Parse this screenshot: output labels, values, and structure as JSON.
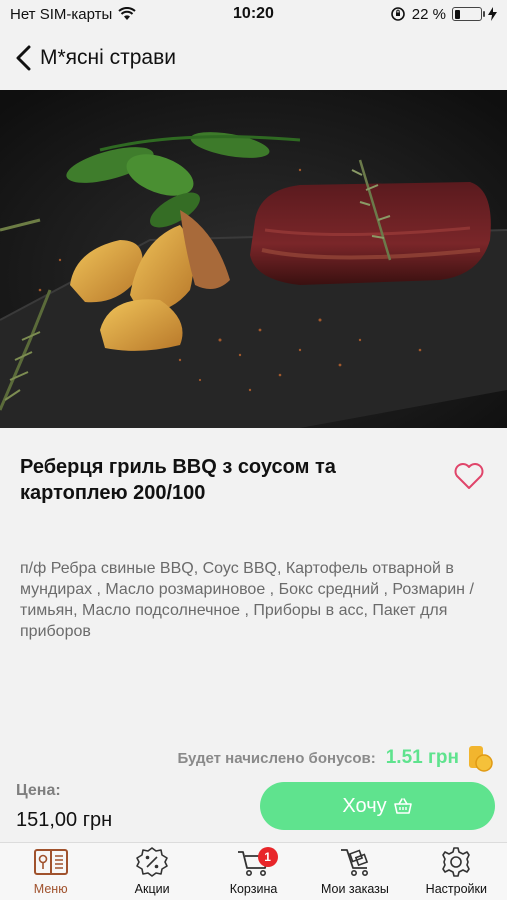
{
  "status_bar": {
    "carrier": "Нет SIM-карты",
    "time": "10:20",
    "battery_percent": "22 %",
    "battery_level": 0.22
  },
  "nav": {
    "back_title": "М*ясні страви"
  },
  "product": {
    "title": "Реберця гриль BBQ з соусом та картоплею 200/100",
    "description": "п/ф Ребра свиные BBQ, Соус BBQ, Картофель отварной в мундирах , Масло розмариновое , Бокс средний , Розмарин /тимьян, Масло подсолнечное , Приборы в асс, Пакет для приборов"
  },
  "bonus": {
    "label": "Будет начислено бонусов:",
    "value": "1.51 грн"
  },
  "price": {
    "label": "Цена:",
    "value": "151,00 грн"
  },
  "actions": {
    "want_label": "Хочу"
  },
  "tabs": [
    {
      "label": "Меню",
      "icon": "menu-book-icon",
      "active": true
    },
    {
      "label": "Акции",
      "icon": "discount-icon",
      "active": false
    },
    {
      "label": "Корзина",
      "icon": "cart-icon",
      "active": false,
      "badge": "1"
    },
    {
      "label": "Мои заказы",
      "icon": "orders-trolley-icon",
      "active": false
    },
    {
      "label": "Настройки",
      "icon": "gear-icon",
      "active": false
    }
  ],
  "colors": {
    "accent_green": "#5fe38e",
    "active_tab": "#a0522d",
    "badge_red": "#e8262a",
    "heart_pink": "#e0456a"
  }
}
